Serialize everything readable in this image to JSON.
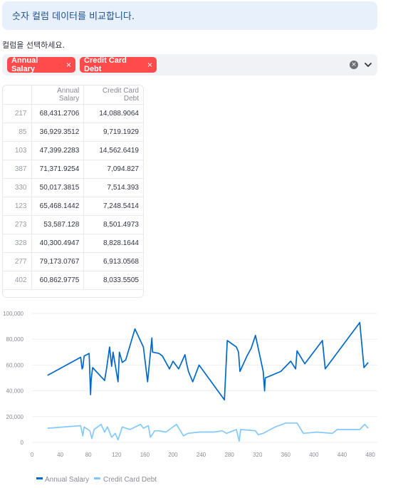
{
  "info": {
    "text": "숫자 컬럼 데이터를 비교합니다."
  },
  "select": {
    "label": "컬럼을 선택하세요.",
    "tags": [
      {
        "label": "Annual Salary",
        "remove": "×"
      },
      {
        "label": "Credit Card Debt",
        "remove": "×"
      }
    ],
    "clear_icon": "×"
  },
  "table": {
    "columns": [
      "",
      "Annual Salary",
      "Credit Card Debt"
    ],
    "rows": [
      [
        "217",
        "68,431.2706",
        "14,088.9064"
      ],
      [
        "85",
        "36,929.3512",
        "9,719.1929"
      ],
      [
        "103",
        "47,399.2283",
        "14,562.6419"
      ],
      [
        "387",
        "71,371.9254",
        "7,094.827"
      ],
      [
        "330",
        "50,017.3815",
        "7,514.393"
      ],
      [
        "123",
        "65,468.1442",
        "7,248.5414"
      ],
      [
        "273",
        "53,587.128",
        "8,501.4973"
      ],
      [
        "328",
        "40,300.4947",
        "8,828.1644"
      ],
      [
        "277",
        "79,173.0767",
        "6,913.0568"
      ],
      [
        "402",
        "60,862.9775",
        "8,033.5505"
      ]
    ]
  },
  "chart_data": {
    "type": "line",
    "xlim": [
      0,
      490
    ],
    "ylim": [
      0,
      100000
    ],
    "x_ticks": [
      "0",
      "40",
      "80",
      "120",
      "160",
      "200",
      "240",
      "280",
      "320",
      "360",
      "400",
      "440",
      "480"
    ],
    "y_ticks": [
      "0",
      "20,000",
      "40,000",
      "60,000",
      "80,000",
      "100,000"
    ],
    "grid": "horizontal",
    "legend_position": "bottom-left",
    "series": [
      {
        "name": "Annual Salary",
        "color": "#0068c9",
        "points": [
          [
            22,
            52000
          ],
          [
            69,
            66000
          ],
          [
            71,
            57000
          ],
          [
            72,
            58000
          ],
          [
            74,
            67000
          ],
          [
            81,
            69000
          ],
          [
            83,
            37000
          ],
          [
            84,
            49000
          ],
          [
            86,
            58000
          ],
          [
            103,
            48000
          ],
          [
            106,
            58000
          ],
          [
            110,
            74000
          ],
          [
            113,
            59000
          ],
          [
            115,
            70000
          ],
          [
            122,
            47000
          ],
          [
            124,
            70000
          ],
          [
            128,
            62000
          ],
          [
            133,
            64000
          ],
          [
            146,
            88000
          ],
          [
            158,
            74000
          ],
          [
            164,
            47000
          ],
          [
            170,
            81000
          ],
          [
            171,
            70000
          ],
          [
            180,
            69000
          ],
          [
            185,
            67000
          ],
          [
            195,
            57000
          ],
          [
            200,
            63000
          ],
          [
            208,
            57000
          ],
          [
            217,
            68000
          ],
          [
            219,
            62000
          ],
          [
            222,
            55000
          ],
          [
            228,
            47000
          ],
          [
            237,
            60000
          ],
          [
            273,
            33000
          ],
          [
            277,
            79000
          ],
          [
            290,
            74000
          ],
          [
            293,
            70000
          ],
          [
            295,
            55000
          ],
          [
            305,
            67000
          ],
          [
            311,
            73000
          ],
          [
            317,
            83000
          ],
          [
            328,
            55000
          ],
          [
            330,
            40000
          ],
          [
            331,
            50000
          ],
          [
            353,
            55000
          ],
          [
            367,
            63000
          ],
          [
            374,
            57000
          ],
          [
            376,
            71000
          ],
          [
            387,
            61000
          ],
          [
            412,
            79000
          ],
          [
            416,
            57000
          ],
          [
            465,
            93000
          ],
          [
            471,
            58000
          ],
          [
            477,
            62000
          ]
        ]
      },
      {
        "name": "Credit Card Debt",
        "color": "#83c9ff",
        "points": [
          [
            22,
            11000
          ],
          [
            69,
            13000
          ],
          [
            72,
            5000
          ],
          [
            74,
            12000
          ],
          [
            82,
            9000
          ],
          [
            85,
            3000
          ],
          [
            88,
            10000
          ],
          [
            98,
            14000
          ],
          [
            103,
            8000
          ],
          [
            107,
            12000
          ],
          [
            113,
            4000
          ],
          [
            118,
            7000
          ],
          [
            122,
            2000
          ],
          [
            128,
            12000
          ],
          [
            139,
            10000
          ],
          [
            154,
            14000
          ],
          [
            158,
            11000
          ],
          [
            165,
            13000
          ],
          [
            168,
            4000
          ],
          [
            174,
            9000
          ],
          [
            180,
            9000
          ],
          [
            190,
            8000
          ],
          [
            205,
            14000
          ],
          [
            215,
            5000
          ],
          [
            221,
            7000
          ],
          [
            237,
            8000
          ],
          [
            258,
            8000
          ],
          [
            270,
            9000
          ],
          [
            276,
            7000
          ],
          [
            290,
            10000
          ],
          [
            294,
            1000
          ],
          [
            296,
            10000
          ],
          [
            317,
            9000
          ],
          [
            321,
            6000
          ],
          [
            328,
            7000
          ],
          [
            345,
            12000
          ],
          [
            360,
            15000
          ],
          [
            376,
            15000
          ],
          [
            385,
            7000
          ],
          [
            404,
            8000
          ],
          [
            426,
            7000
          ],
          [
            433,
            10000
          ],
          [
            465,
            10000
          ],
          [
            472,
            14000
          ],
          [
            477,
            11000
          ]
        ]
      }
    ]
  }
}
